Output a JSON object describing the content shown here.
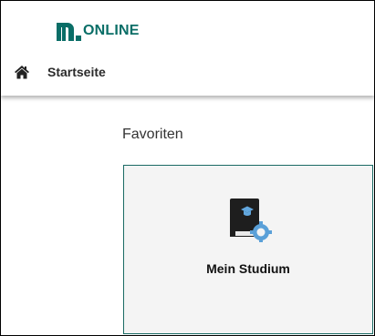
{
  "app": {
    "logo_text": "ONLINE",
    "logo_color": "#0a6e67"
  },
  "nav": {
    "home_icon": "home-icon",
    "home_label": "Startseite"
  },
  "favorites": {
    "title": "Favoriten",
    "tiles": [
      {
        "label": "Mein Studium",
        "icon": "study-book-gear-icon"
      }
    ]
  },
  "colors": {
    "accent": "#0a6e67",
    "tile_border": "#1a6a64",
    "tile_background": "#f4f4f4"
  }
}
